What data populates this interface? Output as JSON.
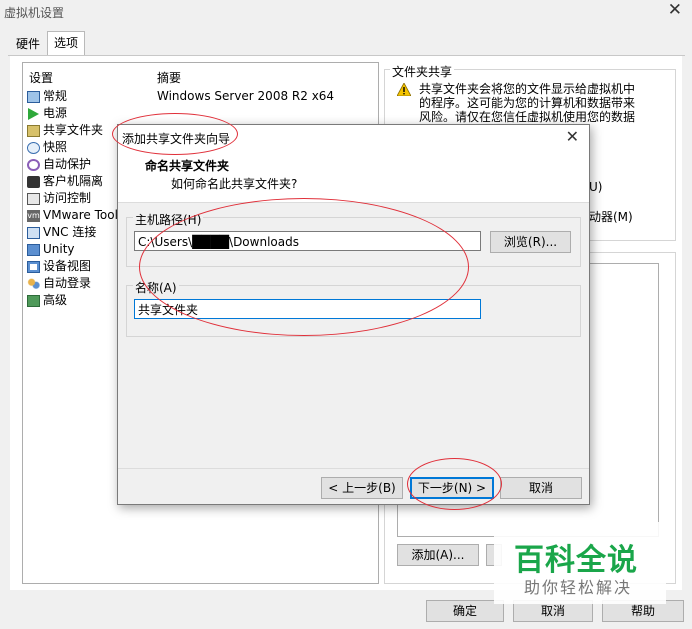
{
  "window": {
    "title": "虚拟机设置",
    "close_glyph": "✕"
  },
  "tabs": [
    {
      "label": "硬件"
    },
    {
      "label": "选项"
    }
  ],
  "settings_list": {
    "col_setting": "设置",
    "col_summary": "摘要",
    "items": [
      {
        "label": "常规",
        "summary": "Windows Server 2008 R2 x64",
        "icon": "monitor-icon"
      },
      {
        "label": "电源",
        "summary": "",
        "icon": "play-icon"
      },
      {
        "label": "共享文件夹",
        "summary": "",
        "icon": "shared-folder-icon"
      },
      {
        "label": "快照",
        "summary": "",
        "icon": "snapshot-icon"
      },
      {
        "label": "自动保护",
        "summary": "",
        "icon": "autoprotect-icon"
      },
      {
        "label": "客户机隔离",
        "summary": "",
        "icon": "lock-icon"
      },
      {
        "label": "访问控制",
        "summary": "",
        "icon": "access-control-icon"
      },
      {
        "label": "VMware Tools",
        "summary": "",
        "icon": "vm-icon"
      },
      {
        "label": "VNC 连接",
        "summary": "",
        "icon": "vnc-icon"
      },
      {
        "label": "Unity",
        "summary": "",
        "icon": "unity-icon"
      },
      {
        "label": "设备视图",
        "summary": "",
        "icon": "device-view-icon"
      },
      {
        "label": "自动登录",
        "summary": "",
        "icon": "users-icon"
      },
      {
        "label": "高级",
        "summary": "",
        "icon": "advanced-icon"
      }
    ]
  },
  "shared_folders": {
    "group_label": "文件夹共享",
    "warning_line1": "共享文件夹会将您的文件显示给虚拟机中",
    "warning_line2": "的程序。这可能为您的计算机和数据带来",
    "warning_line3": "风险。请仅在您信任虚拟机使用您的数据",
    "partial_option_1": "U)",
    "partial_option_2": "动器(M)",
    "add_button": "添加(A)..."
  },
  "wizard": {
    "title": "添加共享文件夹向导",
    "close_glyph": "✕",
    "header_title": "命名共享文件夹",
    "header_subtitle": "如何命名此共享文件夹?",
    "host_path_label": "主机路径(H)",
    "host_path_value": "C:\\Users\\████\\Downloads",
    "browse_button": "浏览(R)...",
    "name_label": "名称(A)",
    "name_value": "共享文件夹",
    "back_button": "< 上一步(B)",
    "next_button": "下一步(N) >",
    "cancel_button": "取消"
  },
  "footer": {
    "ok_button": "确定",
    "cancel_button": "取消",
    "help_button": "帮助"
  },
  "watermark": {
    "brand": "百科全说",
    "slogan": "助你轻松解决"
  },
  "colors": {
    "accent": "#0078d7",
    "annotation": "#e0303a",
    "watermark_green": "#1aa64a"
  }
}
